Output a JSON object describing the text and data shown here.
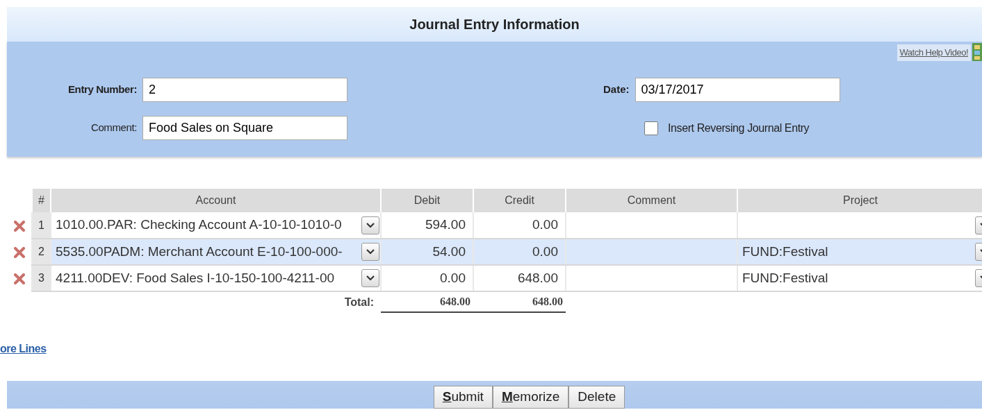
{
  "title": "Journal Entry Information",
  "help_link": "Watch Help Video!",
  "form": {
    "entry_number": {
      "label": "Entry Number:",
      "value": "2"
    },
    "comment": {
      "label": "Comment:",
      "value": "Food Sales on Square"
    },
    "date": {
      "label": "Date:",
      "value": "03/17/2017"
    },
    "reversing": {
      "label": "Insert Reversing Journal Entry",
      "checked": false
    }
  },
  "table": {
    "columns": [
      "#",
      "Account",
      "Debit",
      "Credit",
      "Comment",
      "Project"
    ],
    "rows": [
      {
        "number": "1",
        "account": "1010.00.PAR: Checking Account A-10-10-1010-0",
        "debit": "594.00",
        "credit": "0.00",
        "project": "",
        "selected": false
      },
      {
        "number": "2",
        "account": "5535.00PADM: Merchant Account E-10-100-000-",
        "debit": "54.00",
        "credit": "0.00",
        "project": "FUND:Festival",
        "selected": true
      },
      {
        "number": "3",
        "account": "4211.00DEV: Food Sales I-10-150-100-4211-00",
        "debit": "0.00",
        "credit": "648.00",
        "project": "FUND:Festival",
        "selected": false
      }
    ],
    "total": {
      "label": "Total:",
      "debit": "648.00",
      "credit": "648.00"
    }
  },
  "more_lines": "ore Lines",
  "buttons": [
    {
      "access": "S",
      "rest": "ubmit"
    },
    {
      "access": "M",
      "rest": "emorize"
    },
    {
      "rest": "Delete"
    }
  ]
}
